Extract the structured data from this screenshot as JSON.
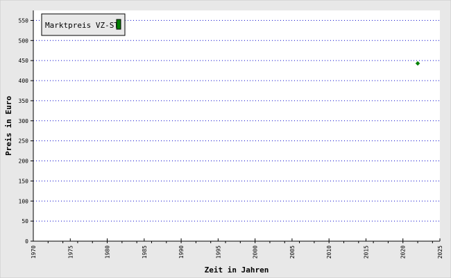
{
  "chart_data": {
    "type": "scatter",
    "title": "",
    "xlabel": "Zeit in Jahren",
    "ylabel": "Preis in Euro",
    "xlim": [
      1970,
      2025
    ],
    "ylim": [
      0,
      575
    ],
    "xticks": [
      1970,
      1975,
      1980,
      1985,
      1990,
      1995,
      2000,
      2005,
      2010,
      2015,
      2020,
      2025
    ],
    "xticks_minor": [
      1972,
      1974,
      1976,
      1978,
      1980,
      1982,
      1984,
      1986,
      1988,
      1990,
      1992,
      1994,
      1996,
      1998,
      2000,
      2002,
      2004,
      2006,
      2008,
      2010,
      2012,
      2014,
      2016,
      2018,
      2020,
      2022,
      2024
    ],
    "yticks": [
      0,
      50,
      100,
      150,
      200,
      250,
      300,
      350,
      400,
      450,
      500,
      550
    ],
    "grid": "horizontal-dotted",
    "legend_position": "top-left",
    "series": [
      {
        "name": "Marktpreis VZ-ST",
        "color": "#008000",
        "marker": "diamond",
        "points": [
          {
            "x": 2022,
            "y": 443
          }
        ]
      }
    ]
  }
}
